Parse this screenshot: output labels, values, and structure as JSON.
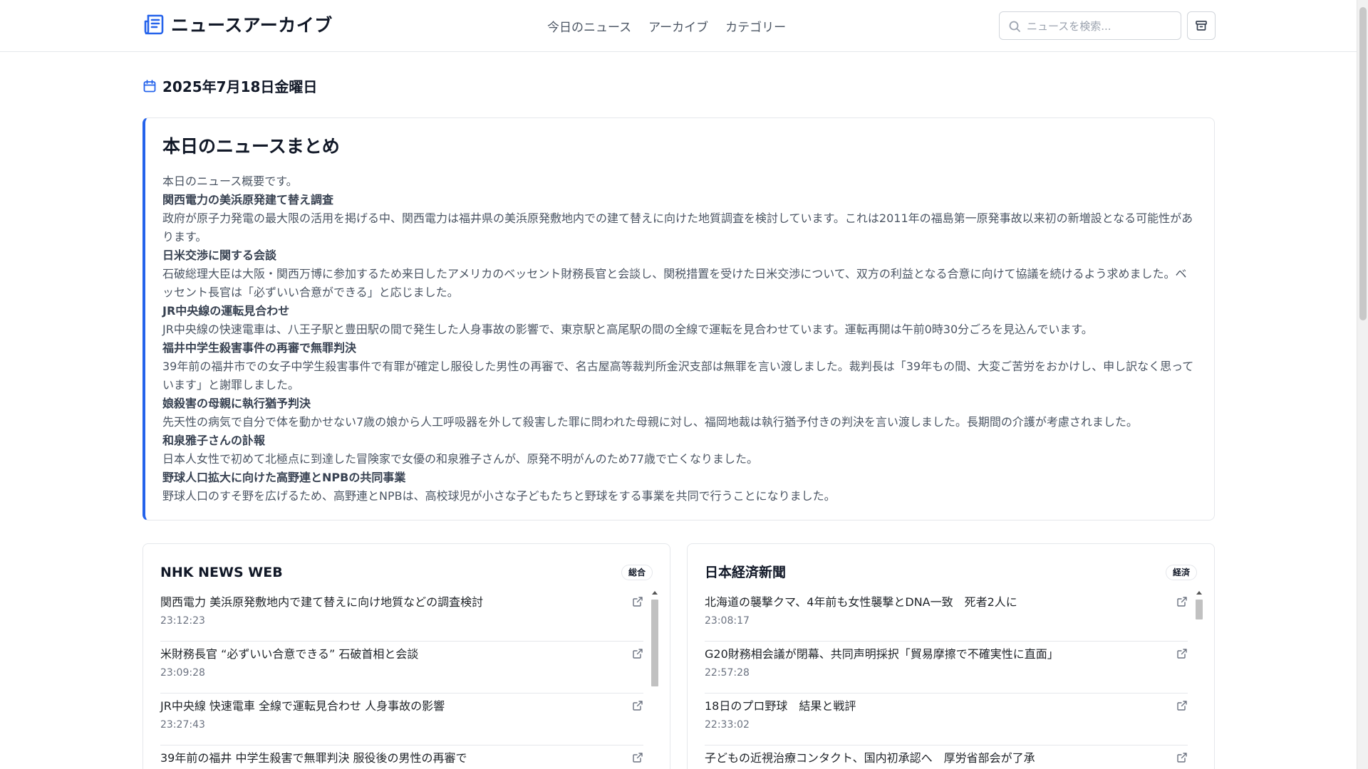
{
  "header": {
    "app_title": "ニュースアーカイブ",
    "nav": [
      "今日のニュース",
      "アーカイブ",
      "カテゴリー"
    ],
    "search_placeholder": "ニュースを検索..."
  },
  "date": "2025年7月18日金曜日",
  "summary": {
    "heading": "本日のニュースまとめ",
    "intro": "本日のニュース概要です。",
    "items": [
      {
        "title": "関西電力の美浜原発建て替え調査",
        "text": "政府が原子力発電の最大限の活用を掲げる中、関西電力は福井県の美浜原発敷地内での建て替えに向けた地質調査を検討しています。これは2011年の福島第一原発事故以来初の新増設となる可能性があります。"
      },
      {
        "title": "日米交渉に関する会談",
        "text": "石破総理大臣は大阪・関西万博に参加するため来日したアメリカのベッセント財務長官と会談し、関税措置を受けた日米交渉について、双方の利益となる合意に向けて協議を続けるよう求めました。ベッセント長官は「必ずいい合意ができる」と応じました。"
      },
      {
        "title": "JR中央線の運転見合わせ",
        "text": "JR中央線の快速電車は、八王子駅と豊田駅の間で発生した人身事故の影響で、東京駅と高尾駅の間の全線で運転を見合わせています。運転再開は午前0時30分ごろを見込んでいます。"
      },
      {
        "title": "福井中学生殺害事件の再審で無罪判決",
        "text": "39年前の福井市での女子中学生殺害事件で有罪が確定し服役した男性の再審で、名古屋高等裁判所金沢支部は無罪を言い渡しました。裁判長は「39年もの間、大変ご苦労をおかけし、申し訳なく思っています」と謝罪しました。"
      },
      {
        "title": "娘殺害の母親に執行猶予判決",
        "text": "先天性の病気で自分で体を動かせない7歳の娘から人工呼吸器を外して殺害した罪に問われた母親に対し、福岡地裁は執行猶予付きの判決を言い渡しました。長期間の介護が考慮されました。"
      },
      {
        "title": "和泉雅子さんの訃報",
        "text": "日本人女性で初めて北極点に到達した冒険家で女優の和泉雅子さんが、原発不明がんのため77歳で亡くなりました。"
      },
      {
        "title": "野球人口拡大に向けた高野連とNPBの共同事業",
        "text": "野球人口のすそ野を広げるため、高野連とNPBは、高校球児が小さな子どもたちと野球をする事業を共同で行うことになりました。"
      }
    ]
  },
  "sources": [
    {
      "name": "NHK NEWS WEB",
      "category": "総合",
      "articles": [
        {
          "title": "関西電力 美浜原発敷地内で建て替えに向け地質などの調査検討",
          "time": "23:12:23"
        },
        {
          "title": "米財務長官 “必ずいい合意できる” 石破首相と会談",
          "time": "23:09:28"
        },
        {
          "title": "JR中央線 快速電車 全線で運転見合わせ 人身事故の影響",
          "time": "23:27:43"
        },
        {
          "title": "39年前の福井 中学生殺害で無罪判決 服役後の男性の再審で",
          "time": ""
        }
      ]
    },
    {
      "name": "日本経済新聞",
      "category": "経済",
      "articles": [
        {
          "title": "北海道の襲撃クマ、4年前も女性襲撃とDNA一致　死者2人に",
          "time": "23:08:17"
        },
        {
          "title": "G20財務相会議が閉幕、共同声明採択「貿易摩擦で不確実性に直面」",
          "time": "22:57:28"
        },
        {
          "title": "18日のプロ野球　結果と戦評",
          "time": "22:33:02"
        },
        {
          "title": "子どもの近視治療コンタクト、国内初承認へ　厚労省部会が了承",
          "time": ""
        }
      ]
    }
  ],
  "colors": {
    "accent": "#2563eb",
    "border": "#e5e7eb",
    "muted": "#6b7280"
  },
  "icons": {
    "logo": "newspaper-icon",
    "search": "search-icon",
    "archive": "archive-icon",
    "calendar": "calendar-icon",
    "external": "external-link-icon"
  }
}
